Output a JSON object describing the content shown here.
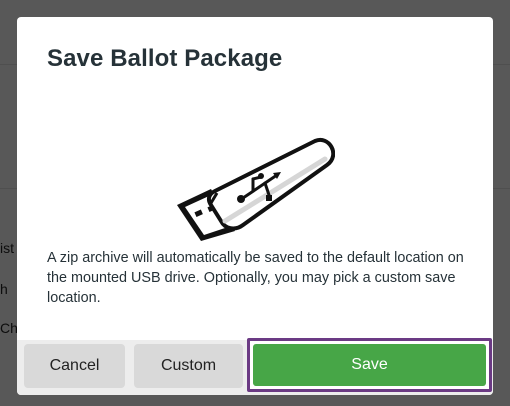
{
  "background": {
    "fragments": [
      "ist",
      "h",
      "Ch"
    ]
  },
  "modal": {
    "title": "Save Ballot Package",
    "illustration_icon": "usb-drive-icon",
    "body": "A zip archive will automatically be saved to the default location on the mounted USB drive. Optionally, you may pick a custom save location."
  },
  "buttons": {
    "cancel_label": "Cancel",
    "custom_label": "Custom",
    "save_label": "Save"
  },
  "colors": {
    "primary_button": "#47a647",
    "focus_ring": "#6b3a84",
    "secondary_button": "#d9d9d9",
    "text": "#263238"
  }
}
